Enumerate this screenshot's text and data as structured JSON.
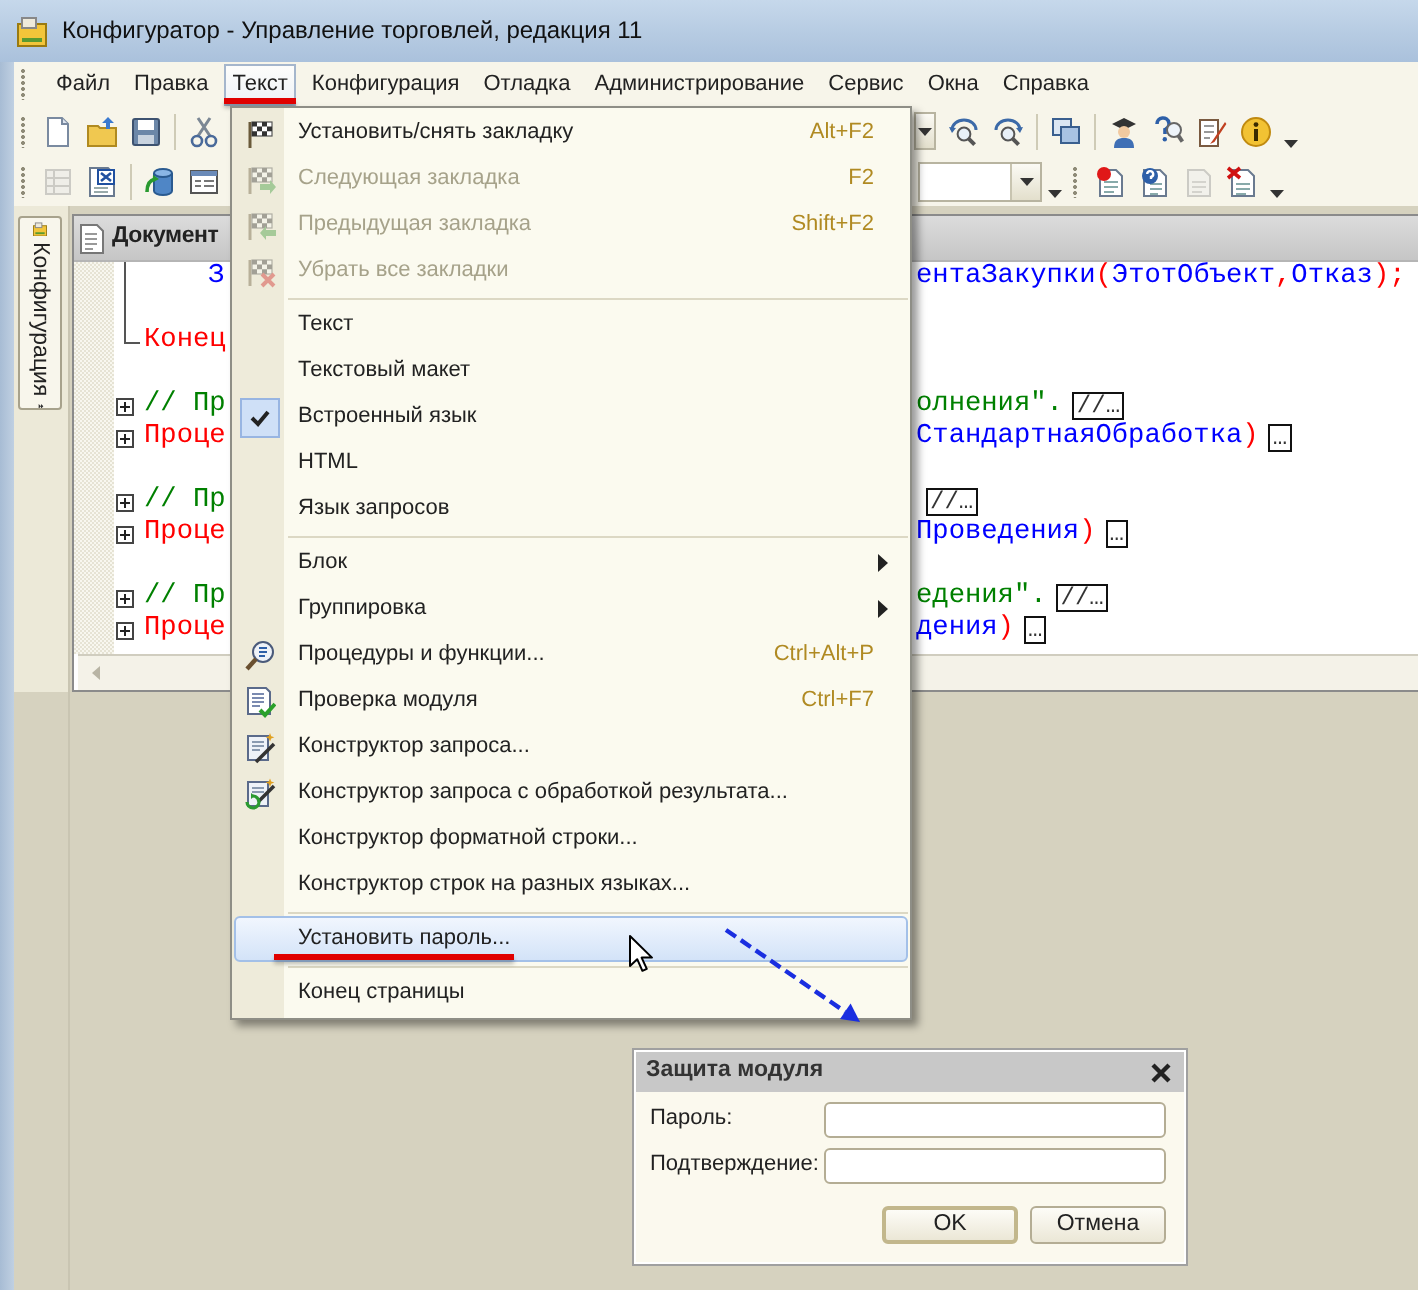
{
  "window": {
    "title": "Конфигуратор - Управление торговлей, редакция 11"
  },
  "menu_bar": [
    {
      "label": "Файл",
      "selected": false,
      "marked": false
    },
    {
      "label": "Правка",
      "selected": false,
      "marked": false
    },
    {
      "label": "Текст",
      "selected": true,
      "marked": true
    },
    {
      "label": "Конфигурация",
      "selected": false,
      "marked": false
    },
    {
      "label": "Отладка",
      "selected": false,
      "marked": false
    },
    {
      "label": "Администрирование",
      "selected": false,
      "marked": false
    },
    {
      "label": "Сервис",
      "selected": false,
      "marked": false
    },
    {
      "label": "Окна",
      "selected": false,
      "marked": false
    },
    {
      "label": "Справка",
      "selected": false,
      "marked": false
    }
  ],
  "toolbars": [
    {
      "left": [
        {
          "kind": "grip"
        },
        {
          "kind": "button",
          "disabled": false
        },
        {
          "kind": "button",
          "disabled": false
        },
        {
          "kind": "button",
          "disabled": false
        },
        {
          "kind": "separator"
        },
        {
          "kind": "button",
          "disabled": false
        }
      ],
      "right": [
        {
          "kind": "combo_button"
        },
        {
          "kind": "button",
          "disabled": false
        },
        {
          "kind": "button",
          "disabled": false
        },
        {
          "kind": "separator"
        },
        {
          "kind": "button",
          "disabled": false
        },
        {
          "kind": "separator"
        },
        {
          "kind": "button",
          "disabled": false
        },
        {
          "kind": "button",
          "disabled": false
        },
        {
          "kind": "button",
          "disabled": false
        },
        {
          "kind": "button",
          "disabled": false
        },
        {
          "kind": "overflow"
        }
      ]
    },
    {
      "left": [
        {
          "kind": "grip"
        },
        {
          "kind": "button",
          "disabled": true
        },
        {
          "kind": "button",
          "disabled": false
        },
        {
          "kind": "separator"
        },
        {
          "kind": "button",
          "disabled": false
        },
        {
          "kind": "button",
          "disabled": false
        }
      ],
      "right": [
        {
          "kind": "combo"
        },
        {
          "kind": "overflow"
        },
        {
          "kind": "grip"
        },
        {
          "kind": "button",
          "disabled": false
        },
        {
          "kind": "button",
          "disabled": false
        },
        {
          "kind": "button",
          "disabled": true
        },
        {
          "kind": "button",
          "disabled": false
        },
        {
          "kind": "overflow"
        }
      ]
    }
  ],
  "side_panel": {
    "tab": "Конфигурация"
  },
  "editor": {
    "title": "Документ",
    "lines": [
      {
        "kind": "body",
        "left": [
          {
            "kind": "identifier",
            "text": "З"
          }
        ],
        "right": [
          {
            "kind": "identifier",
            "text": "ентаЗакупки"
          },
          {
            "kind": "punct",
            "text": "("
          },
          {
            "kind": "identifier",
            "text": "ЭтотОбъект"
          },
          {
            "kind": "punct",
            "text": ","
          },
          {
            "kind": "identifier",
            "text": "Отказ"
          },
          {
            "kind": "punct",
            "text": ");"
          }
        ]
      },
      {
        "kind": "body"
      },
      {
        "kind": "end",
        "left": [
          {
            "kind": "keyword",
            "text": "Конец"
          }
        ]
      },
      {
        "kind": "blank"
      },
      {
        "kind": "fold",
        "left": [
          {
            "kind": "comment",
            "text": "// Пр"
          }
        ],
        "right": [
          {
            "kind": "comment",
            "text": "олнения\"."
          },
          {
            "kind": "collapsed",
            "text": "//…"
          }
        ]
      },
      {
        "kind": "fold",
        "left": [
          {
            "kind": "keyword",
            "text": "Проце"
          }
        ],
        "right": [
          {
            "kind": "identifier",
            "text": "СтандартнаяОбработка"
          },
          {
            "kind": "punct",
            "text": ")"
          },
          {
            "kind": "collapsed",
            "text": "…"
          }
        ]
      },
      {
        "kind": "blank"
      },
      {
        "kind": "fold",
        "left": [
          {
            "kind": "comment",
            "text": "// Пр"
          }
        ],
        "right": [
          {
            "kind": "collapsed",
            "text": "//…"
          }
        ]
      },
      {
        "kind": "fold",
        "left": [
          {
            "kind": "keyword",
            "text": "Проце"
          }
        ],
        "right": [
          {
            "kind": "identifier",
            "text": "Проведения"
          },
          {
            "kind": "punct",
            "text": ")"
          },
          {
            "kind": "collapsed",
            "text": "…"
          }
        ]
      },
      {
        "kind": "blank"
      },
      {
        "kind": "fold",
        "left": [
          {
            "kind": "comment",
            "text": "// Пр"
          }
        ],
        "right": [
          {
            "kind": "comment",
            "text": "едения\"."
          },
          {
            "kind": "collapsed",
            "text": "//…"
          }
        ]
      },
      {
        "kind": "fold",
        "left": [
          {
            "kind": "keyword",
            "text": "Проце"
          }
        ],
        "right": [
          {
            "kind": "identifier",
            "text": "дения"
          },
          {
            "kind": "punct",
            "text": ")"
          },
          {
            "kind": "collapsed",
            "text": "…"
          }
        ]
      }
    ]
  },
  "text_menu": {
    "items": [
      {
        "kind": "item",
        "label": "Установить/снять закладку",
        "shortcut": "Alt+F2",
        "disabled": false,
        "checked": false,
        "selected": false,
        "marked": false
      },
      {
        "kind": "item",
        "label": "Следующая закладка",
        "shortcut": "F2",
        "disabled": true,
        "checked": false,
        "selected": false,
        "marked": false
      },
      {
        "kind": "item",
        "label": "Предыдущая закладка",
        "shortcut": "Shift+F2",
        "disabled": true,
        "checked": false,
        "selected": false,
        "marked": false
      },
      {
        "kind": "item",
        "label": "Убрать все закладки",
        "disabled": true,
        "checked": false,
        "selected": false,
        "marked": false
      },
      {
        "kind": "separator"
      },
      {
        "kind": "item",
        "label": "Текст",
        "disabled": false,
        "checked": false,
        "selected": false,
        "marked": false
      },
      {
        "kind": "item",
        "label": "Текстовый макет",
        "disabled": false,
        "checked": false,
        "selected": false,
        "marked": false
      },
      {
        "kind": "item",
        "label": "Встроенный язык",
        "disabled": false,
        "checked": true,
        "selected": false,
        "marked": false
      },
      {
        "kind": "item",
        "label": "HTML",
        "disabled": false,
        "checked": false,
        "selected": false,
        "marked": false
      },
      {
        "kind": "item",
        "label": "Язык запросов",
        "disabled": false,
        "checked": false,
        "selected": false,
        "marked": false
      },
      {
        "kind": "separator"
      },
      {
        "kind": "submenu",
        "label": "Блок",
        "disabled": false,
        "checked": false,
        "selected": false,
        "marked": false
      },
      {
        "kind": "submenu",
        "label": "Группировка",
        "disabled": false,
        "checked": false,
        "selected": false,
        "marked": false
      },
      {
        "kind": "item",
        "label": "Процедуры и функции...",
        "shortcut": "Ctrl+Alt+P",
        "disabled": false,
        "checked": false,
        "selected": false,
        "marked": false
      },
      {
        "kind": "item",
        "label": "Проверка модуля",
        "shortcut": "Ctrl+F7",
        "disabled": false,
        "checked": false,
        "selected": false,
        "marked": false
      },
      {
        "kind": "item",
        "label": "Конструктор запроса...",
        "disabled": false,
        "checked": false,
        "selected": false,
        "marked": false
      },
      {
        "kind": "item",
        "label": "Конструктор запроса с обработкой результата...",
        "disabled": false,
        "checked": false,
        "selected": false,
        "marked": false
      },
      {
        "kind": "item",
        "label": "Конструктор форматной строки...",
        "disabled": false,
        "checked": false,
        "selected": false,
        "marked": false
      },
      {
        "kind": "item",
        "label": "Конструктор строк на разных языках...",
        "disabled": false,
        "checked": false,
        "selected": false,
        "marked": false
      },
      {
        "kind": "separator"
      },
      {
        "kind": "item",
        "label": "Установить пароль...",
        "disabled": false,
        "checked": false,
        "selected": true,
        "marked": true
      },
      {
        "kind": "separator"
      },
      {
        "kind": "item",
        "label": "Конец страницы",
        "disabled": false,
        "checked": false,
        "selected": false,
        "marked": false
      }
    ]
  },
  "dialog": {
    "title": "Защита модуля",
    "fields": [
      {
        "label": "Пароль:"
      },
      {
        "label": "Подтверждение:"
      }
    ],
    "buttons": [
      {
        "label": "OK",
        "default": true
      },
      {
        "label": "Отмена",
        "default": false
      }
    ]
  }
}
